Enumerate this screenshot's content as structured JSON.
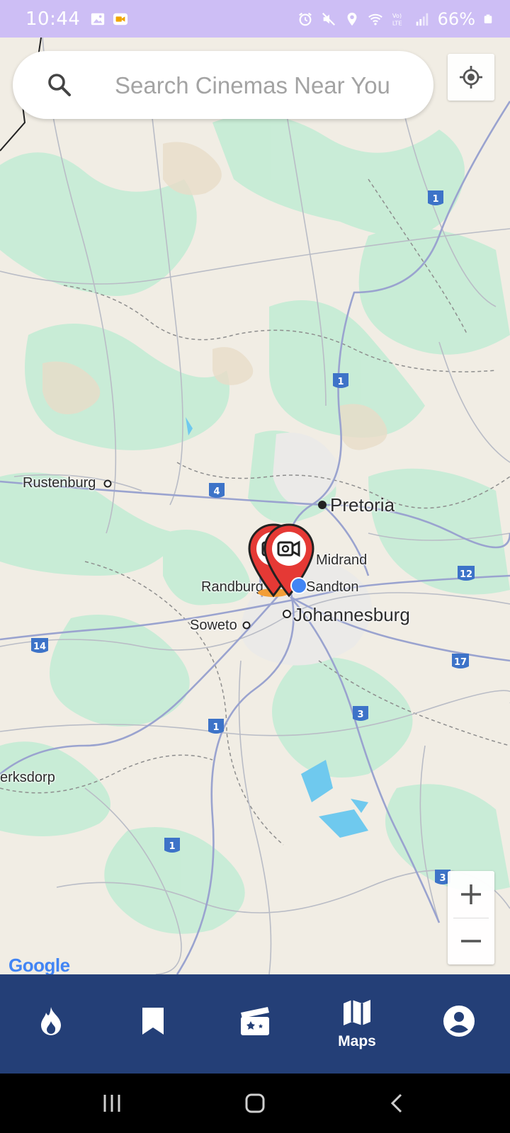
{
  "status_bar": {
    "time": "10:44",
    "battery": "66%",
    "left_icons": [
      "gallery-icon",
      "video-call-icon"
    ],
    "right_icons": [
      "alarm-icon",
      "mute-icon",
      "location-icon",
      "wifi-icon",
      "volte-icon",
      "signal-icon",
      "battery-icon"
    ]
  },
  "search": {
    "placeholder": "Search Cinemas Near You",
    "value": ""
  },
  "map": {
    "places": {
      "rustenburg": "Rustenburg",
      "pretoria": "Pretoria",
      "midrand": "Midrand",
      "randburg": "Randburg",
      "sandton": "Sandton",
      "soweto": "Soweto",
      "johannesburg": "Johannesburg",
      "klerksdorp": "erksdorp"
    },
    "route_shields": [
      "1",
      "1",
      "4",
      "12",
      "14",
      "17",
      "3",
      "1",
      "1",
      "3"
    ],
    "attribution": "Google",
    "markers": [
      "cinema-marker",
      "cinema-marker"
    ]
  },
  "zoom": {
    "in": "+",
    "out": "−"
  },
  "bottom_nav": {
    "items": [
      {
        "icon": "fire-icon",
        "label": ""
      },
      {
        "icon": "bookmark-icon",
        "label": ""
      },
      {
        "icon": "movie-clapper-icon",
        "label": ""
      },
      {
        "icon": "map-icon",
        "label": "Maps",
        "active": true
      },
      {
        "icon": "account-icon",
        "label": ""
      }
    ]
  },
  "colors": {
    "status_bar": "#cdbef5",
    "nav_bar": "#243f77",
    "marker": "#e53935",
    "route_shield": "#3d73c8"
  }
}
